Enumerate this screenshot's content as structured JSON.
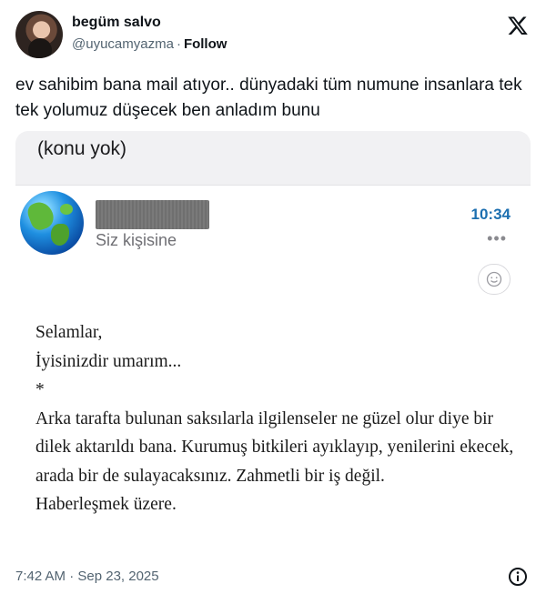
{
  "author": {
    "name": "begüm salvo",
    "handle": "@uyucamyazma",
    "separator": "·",
    "follow_label": "Follow"
  },
  "tweet": {
    "text": "ev sahibim bana mail atıyor.. dünyadaki tüm numune insanlara tek tek yolumuz düşecek ben anladım bunu"
  },
  "email": {
    "subject": "(konu yok)",
    "to_line": "Siz kişisine",
    "time": "10:34",
    "more_glyph": "•••",
    "body_lines": [
      "Selamlar,",
      "İyisinizdir umarım...",
      "*",
      "Arka tarafta bulunan saksılarla ilgilenseler ne güzel olur diye bir dilek aktarıldı bana. Kurumuş bitkileri ayıklayıp, yenilerini ekecek, arada bir de sulayacaksınız. Zahmetli bir iş değil.",
      "Haberleşmek üzere."
    ]
  },
  "footer": {
    "timestamp": "7:42 AM · Sep 23, 2025"
  },
  "icons": {
    "brand": "x-logo-icon",
    "info": "info-icon",
    "reaction": "smiley-icon",
    "sender_avatar": "globe-icon"
  },
  "colors": {
    "time_blue": "#1c6fb0",
    "muted_text": "#536471",
    "subject_bar": "#f1f1f3"
  }
}
